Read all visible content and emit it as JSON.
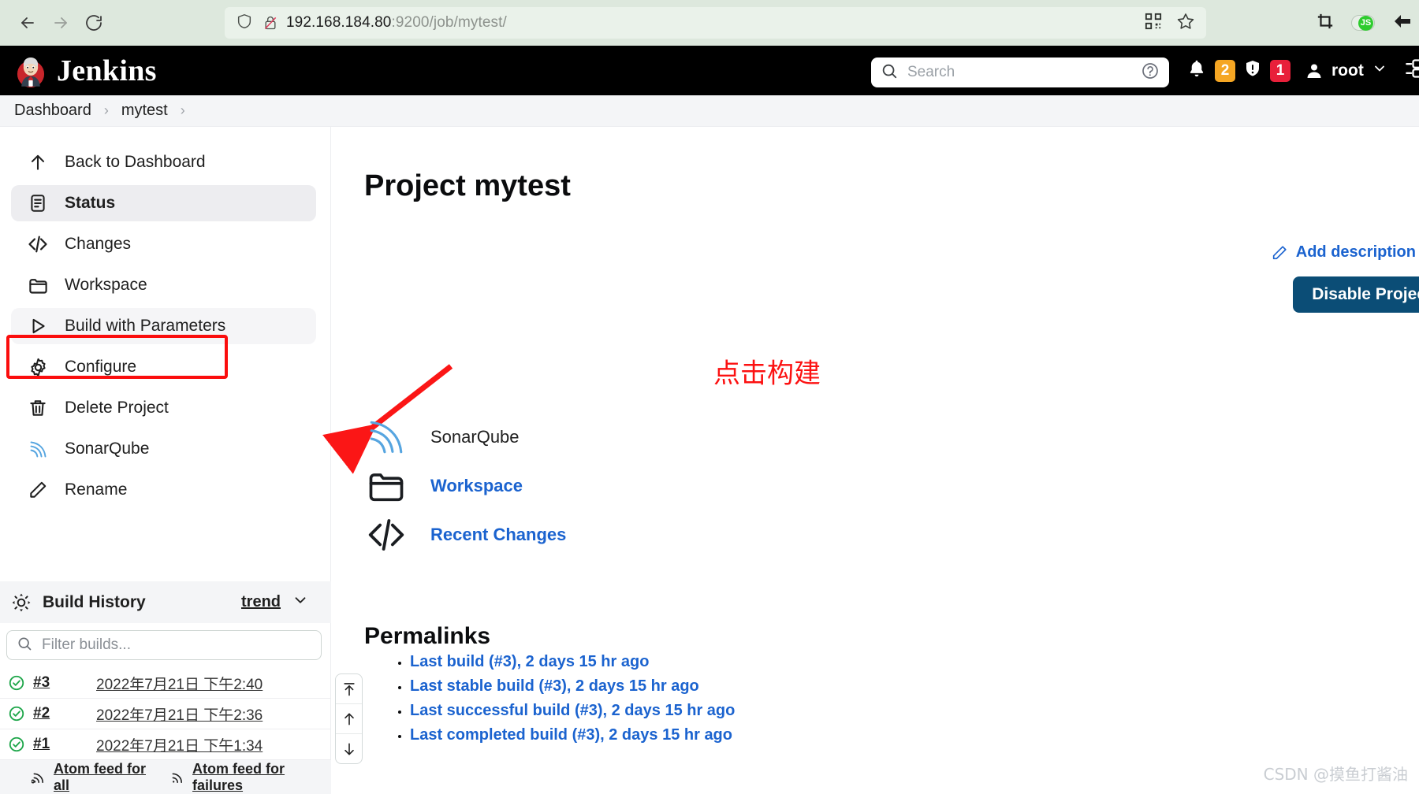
{
  "browser": {
    "back_label": "back-arrow",
    "forward_label": "forward-arrow",
    "reload_label": "reload",
    "url_host": "192.168.184.80",
    "url_rest": ":9200/job/mytest/",
    "qr_icon": "qr-code-icon",
    "bookmark_icon": "star-icon",
    "shield_icon": "shield-icon",
    "insecure_icon": "broken-lock-icon",
    "screenshot_icon": "crop-icon",
    "js_toggle_label": "JS",
    "pocket_icon": "back-arrow-icon"
  },
  "header": {
    "brand": "Jenkins",
    "search_placeholder": "Search",
    "search_value": "",
    "help_icon": "question-circle-icon",
    "bell_icon": "bell-icon",
    "notification_count": "2",
    "notification_color": "#f5a623",
    "security_icon": "shield-exclamation-icon",
    "security_count": "1",
    "security_color": "#e8203a",
    "user_icon": "person-icon",
    "user_name": "root",
    "user_chevron": "chevron-down-icon",
    "menu_icon": "sidebar-toggle-icon"
  },
  "breadcrumb": {
    "items": [
      "Dashboard",
      "mytest"
    ],
    "separator": "›"
  },
  "sidebar": {
    "items": [
      {
        "label": "Back to Dashboard",
        "icon": "arrow-up-icon",
        "state": "normal"
      },
      {
        "label": "Status",
        "icon": "document-icon",
        "state": "active"
      },
      {
        "label": "Changes",
        "icon": "code-icon",
        "state": "normal"
      },
      {
        "label": "Workspace",
        "icon": "folder-icon",
        "state": "normal"
      },
      {
        "label": "Build with Parameters",
        "icon": "play-icon",
        "state": "hover"
      },
      {
        "label": "Configure",
        "icon": "gear-icon",
        "state": "normal"
      },
      {
        "label": "Delete Project",
        "icon": "trash-icon",
        "state": "normal"
      },
      {
        "label": "SonarQube",
        "icon": "sonarqube-icon",
        "state": "normal"
      },
      {
        "label": "Rename",
        "icon": "pencil-icon",
        "state": "normal"
      }
    ],
    "highlight_box_color": "#fb0d0d"
  },
  "build_history": {
    "title": "Build History",
    "icon": "build-history-icon",
    "trend_label": "trend",
    "chevron_icon": "chevron-down-icon",
    "filter_placeholder": "Filter builds...",
    "filter_value": "",
    "search_icon": "search-icon",
    "builds": [
      {
        "number": "#3",
        "date": "2022年7月21日 下午2:40",
        "status": "success"
      },
      {
        "number": "#2",
        "date": "2022年7月21日 下午2:36",
        "status": "success"
      },
      {
        "number": "#1",
        "date": "2022年7月21日 下午1:34",
        "status": "success"
      }
    ],
    "atom_feeds": [
      {
        "label": "Atom feed for all",
        "icon": "rss-icon"
      },
      {
        "label": "Atom feed for failures",
        "icon": "rss-icon"
      }
    ],
    "scroll_buttons": [
      {
        "icon": "jump-to-top-icon"
      },
      {
        "icon": "arrow-up-icon"
      },
      {
        "icon": "arrow-down-icon"
      }
    ]
  },
  "main": {
    "page_title": "Project mytest",
    "annotation_text": "点击构建",
    "annotation_color": "#fc1111",
    "links": [
      {
        "label": "SonarQube",
        "icon": "sonarqube-icon",
        "style": "plain"
      },
      {
        "label": "Workspace",
        "icon": "folder-icon",
        "style": "blue"
      },
      {
        "label": "Recent Changes",
        "icon": "code-icon",
        "style": "blue"
      }
    ],
    "permalinks_title": "Permalinks",
    "permalinks": [
      "Last build (#3), 2 days 15 hr ago",
      "Last stable build (#3), 2 days 15 hr ago",
      "Last successful build (#3), 2 days 15 hr ago",
      "Last completed build (#3), 2 days 15 hr ago"
    ],
    "add_description_label": "Add description",
    "add_description_icon": "pencil-icon",
    "disable_button_label": "Disable Project",
    "disable_button_color": "#0b4d76"
  },
  "watermark": "CSDN @摸鱼打酱油"
}
